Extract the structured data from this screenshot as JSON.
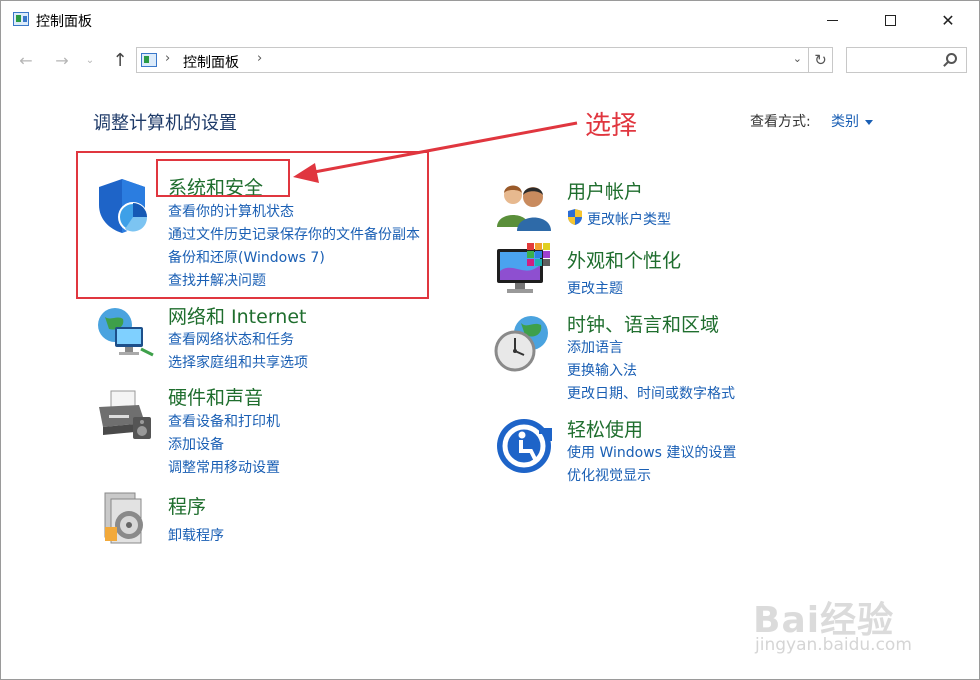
{
  "window": {
    "title": "控制面板"
  },
  "address": {
    "path": "控制面板"
  },
  "content": {
    "heading": "调整计算机的设置",
    "view_label": "查看方式:",
    "view_value": "类别"
  },
  "left_categories": [
    {
      "title": "系统和安全",
      "links": [
        "查看你的计算机状态",
        "通过文件历史记录保存你的文件备份副本",
        "备份和还原(Windows 7)",
        "查找并解决问题"
      ]
    },
    {
      "title": "网络和 Internet",
      "links": [
        "查看网络状态和任务",
        "选择家庭组和共享选项"
      ]
    },
    {
      "title": "硬件和声音",
      "links": [
        "查看设备和打印机",
        "添加设备",
        "调整常用移动设置"
      ]
    },
    {
      "title": "程序",
      "links": [
        "卸载程序"
      ]
    }
  ],
  "right_categories": [
    {
      "title": "用户帐户",
      "links": [
        "更改帐户类型"
      ]
    },
    {
      "title": "外观和个性化",
      "links": [
        "更改主题"
      ]
    },
    {
      "title": "时钟、语言和区域",
      "links": [
        "添加语言",
        "更换输入法",
        "更改日期、时间或数字格式"
      ]
    },
    {
      "title": "轻松使用",
      "links": [
        "使用 Windows 建议的设置",
        "优化视觉显示"
      ]
    }
  ],
  "annotation": {
    "label": "选择",
    "color": "#e0363f"
  },
  "watermark": {
    "brand": "Bai经验",
    "url": "jingyan.baidu.com"
  },
  "colors": {
    "category_title": "#1f6e2e",
    "link": "#1a5fb4",
    "heading": "#1e3a68"
  }
}
